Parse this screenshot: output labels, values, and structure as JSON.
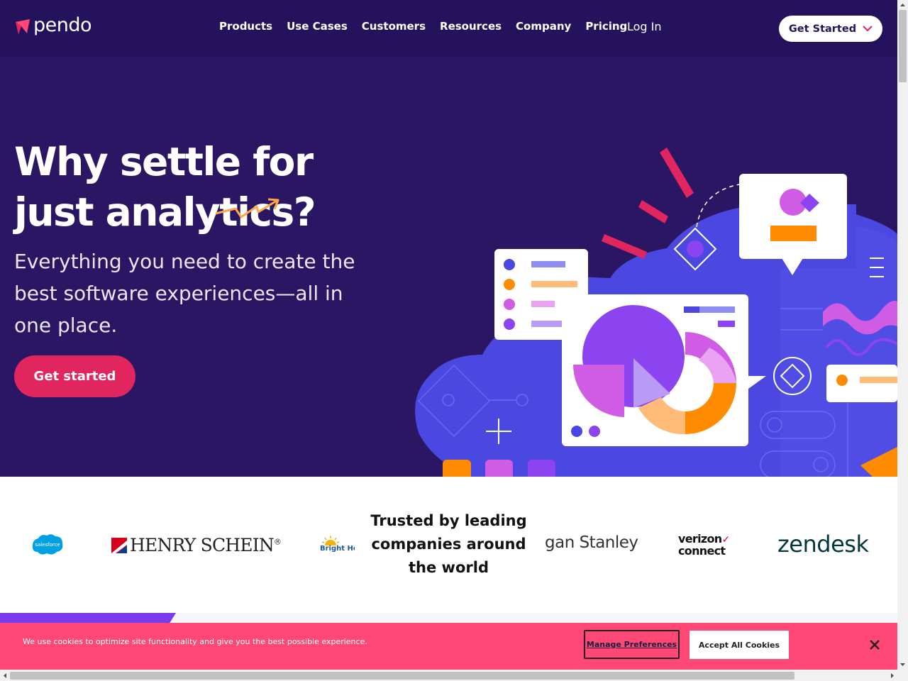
{
  "nav": {
    "logo_text": "pendo",
    "links": [
      "Products",
      "Use Cases",
      "Customers",
      "Resources",
      "Company",
      "Pricing"
    ],
    "login": "Log In",
    "cta": "Get Started"
  },
  "hero": {
    "title": "Why settle for just analytics?",
    "subtitle": "Everything you need to create the best software experiences—all in one place.",
    "cta": "Get started"
  },
  "logos": {
    "trusted_text": "Trusted by leading companies around the world",
    "salesforce": "salesforce",
    "henry_schein": "Henry Schein",
    "bright_horizons": "Bright Hor",
    "morgan_stanley": "gan Stanley",
    "verizon_line1": "verizon",
    "verizon_line2": "connect",
    "zendesk": "zendesk"
  },
  "cookie": {
    "text": "We use cookies to optimize site functionality and give you the best possible experience.",
    "manage": "Manage Preferences",
    "accept": "Accept All Cookies"
  },
  "colors": {
    "nav_bg": "#24135c",
    "hero_bg": "#2a1663",
    "accent": "#e0255f",
    "cookie_bg": "#ff4876"
  }
}
